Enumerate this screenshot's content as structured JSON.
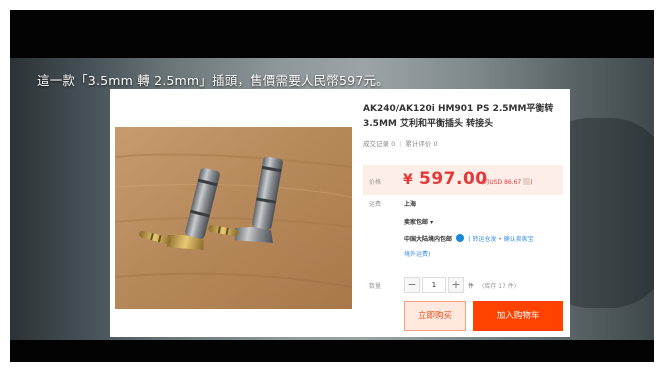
{
  "video": {
    "caption": "這一款「3.5mm 轉 2.5mm」插頭，售價需要人民幣597元。"
  },
  "product": {
    "title": "AK240/AK120i HM901 PS 2.5MM平衡转3.5MM 艾利和平衡插头 转接头",
    "meta": {
      "transactions": "成交记录 0",
      "reviews": "累计评价 0"
    },
    "price_label": "价格",
    "currency_symbol": "¥",
    "price": "597.00",
    "usd_price": "(约USD 86.67",
    "usd_close": ")",
    "shipping_label": "运费",
    "ship_from": "上海",
    "ship_mode": "卖家包邮 ▾",
    "ship_to": "中国大陆境内包邮",
    "ship_note": "(   转运仓发 • 确认卖家宝",
    "ship_note2": "境外运费)",
    "qty_label": "数量",
    "quantity": "1",
    "qty_unit": "件",
    "stock": "(库存 17 件)",
    "buy_now": "立即购买",
    "add_to_cart": "加入购物车"
  },
  "colors": {
    "price_red": "#e4393c",
    "cart_orange": "#ff4200",
    "buy_text": "#e5511d"
  }
}
